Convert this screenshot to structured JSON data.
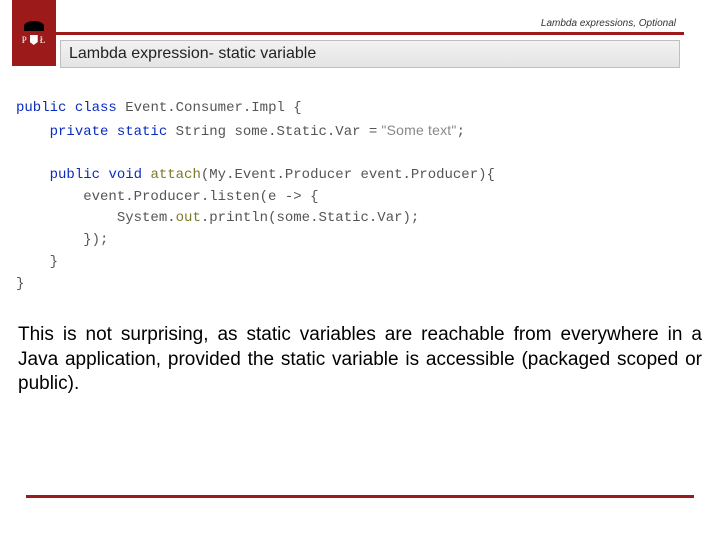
{
  "header": {
    "breadcrumb": "Lambda expressions, Optional",
    "title": "Lambda expression- static variable",
    "logo_letters_left": "P",
    "logo_letters_right": "Ł"
  },
  "code": {
    "l1_kw1": "public",
    "l1_kw2": "class",
    "l1_name": "Event.Consumer.Impl",
    "l1_brace": " {",
    "l2_kw1": "private",
    "l2_kw2": "static",
    "l2_type": "String",
    "l2_var": " some.Static.Var ",
    "l2_eq": "=",
    "l2_str": " \"Some text\"",
    "l2_semi": ";",
    "l4_kw1": "public",
    "l4_kw2": "void",
    "l4_name": " attach",
    "l4_param_open": "(",
    "l4_param_type": "My.Event.Producer event.Producer",
    "l4_param_close": "){",
    "l5": "event.Producer.listen",
    "l5_tail": "(e -> {",
    "l6a": "System.",
    "l6b": "out",
    "l6c": ".println",
    "l6d": "(some.Static.Var);",
    "l7": "});",
    "l8": "}",
    "l9": "}"
  },
  "explain": {
    "text": "This is not surprising, as static variables are reachable from everywhere in a Java application, provided the static variable is accessible (packaged scoped or public)."
  }
}
